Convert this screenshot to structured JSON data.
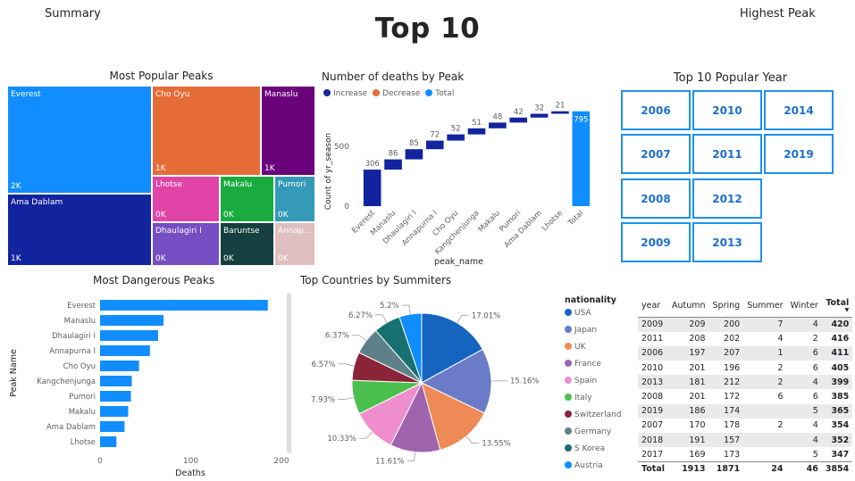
{
  "header": {
    "summary_label": "Summary",
    "title": "Top 10",
    "highest_peak_label": "Highest Peak"
  },
  "colors": {
    "accent": "#118DFF",
    "navy": "#12239E",
    "orange": "#E66C37",
    "purple": "#6B007B",
    "pink": "#E044A7",
    "green": "#1AAB40",
    "teal": "#3599B8",
    "plum": "#744EC2",
    "darkgreen": "#15403F",
    "rose": "#DFBFBF"
  },
  "treemap": {
    "title": "Most Popular Peaks",
    "cells": [
      {
        "label": "Everest",
        "value": "2K",
        "color": "#118DFF"
      },
      {
        "label": "Ama Dablam",
        "value": "1K",
        "color": "#12239E"
      },
      {
        "label": "Cho Oyu",
        "value": "1K",
        "color": "#E66C37"
      },
      {
        "label": "Manaslu",
        "value": "1K",
        "color": "#6B007B"
      },
      {
        "label": "Lhotse",
        "value": "0K",
        "color": "#E044A7"
      },
      {
        "label": "Makalu",
        "value": "0K",
        "color": "#1AAB40"
      },
      {
        "label": "Pumori",
        "value": "0K",
        "color": "#3599B8"
      },
      {
        "label": "Dhaulagiri I",
        "value": "0K",
        "color": "#744EC2"
      },
      {
        "label": "Baruntse",
        "value": "0K",
        "color": "#15403F"
      },
      {
        "label": "Annap...",
        "value": "0K",
        "color": "#DFBFBF"
      }
    ]
  },
  "waterfall": {
    "title": "Number of deaths by Peak",
    "legend": [
      "Increase",
      "Decrease",
      "Total"
    ],
    "legend_colors": [
      "#12239E",
      "#E66C37",
      "#118DFF"
    ],
    "ylabel": "Count of yr_season",
    "xlabel": "peak_name",
    "yticks": [
      "0",
      "500"
    ]
  },
  "year_slicer": {
    "title": "Top 10 Popular Year",
    "years": [
      "2006",
      "2010",
      "2014",
      "2007",
      "2011",
      "2019",
      "2008",
      "2012",
      "2009",
      "2013"
    ]
  },
  "bar": {
    "title": "Most Dangerous Peaks",
    "ylabel": "Peak Name",
    "xlabel": "Deaths",
    "xticks": [
      "0",
      "100",
      "200"
    ]
  },
  "pie": {
    "title": "Top Countries by Summiters",
    "legend_title": "nationality"
  },
  "matrix": {
    "columns": [
      "year",
      "Autumn",
      "Spring",
      "Summer",
      "Winter",
      "Total"
    ],
    "rows": [
      [
        "2009",
        "209",
        "200",
        "7",
        "4",
        "420"
      ],
      [
        "2011",
        "208",
        "202",
        "4",
        "2",
        "416"
      ],
      [
        "2006",
        "197",
        "207",
        "1",
        "6",
        "411"
      ],
      [
        "2010",
        "201",
        "196",
        "2",
        "6",
        "405"
      ],
      [
        "2013",
        "181",
        "212",
        "2",
        "4",
        "399"
      ],
      [
        "2008",
        "201",
        "172",
        "6",
        "6",
        "385"
      ],
      [
        "2019",
        "186",
        "174",
        "",
        "5",
        "365"
      ],
      [
        "2007",
        "170",
        "178",
        "2",
        "4",
        "354"
      ],
      [
        "2018",
        "191",
        "157",
        "",
        "4",
        "352"
      ],
      [
        "2017",
        "169",
        "173",
        "",
        "5",
        "347"
      ]
    ],
    "total": [
      "Total",
      "1913",
      "1871",
      "24",
      "46",
      "3854"
    ]
  },
  "chart_data": [
    {
      "type": "waterfall",
      "title": "Number of deaths by Peak",
      "xlabel": "peak_name",
      "ylabel": "Count of yr_season",
      "categories": [
        "Everest",
        "Manaslu",
        "Dhaulagiri I",
        "Annapurna I",
        "Cho Oyu",
        "Kangchenjunga",
        "Makalu",
        "Pumori",
        "Ama Dablam",
        "Lhotse",
        "Total"
      ],
      "values": [
        306,
        86,
        85,
        72,
        52,
        51,
        48,
        42,
        32,
        21,
        795
      ],
      "labels": [
        "306",
        "86",
        "85",
        "72",
        "52",
        "51",
        "48",
        "42",
        "32",
        "21",
        "795"
      ],
      "ylim": [
        0,
        800
      ]
    },
    {
      "type": "bar",
      "orientation": "horizontal",
      "title": "Most Dangerous Peaks",
      "xlabel": "Deaths",
      "ylabel": "Peak Name",
      "categories": [
        "Everest",
        "Manaslu",
        "Dhaulagiri I",
        "Annapurna I",
        "Cho Oyu",
        "Kangchenjunga",
        "Pumori",
        "Makalu",
        "Ama Dablam",
        "Lhotse"
      ],
      "values": [
        185,
        70,
        64,
        55,
        43,
        35,
        34,
        31,
        27,
        18
      ],
      "xlim": [
        0,
        200
      ]
    },
    {
      "type": "pie",
      "title": "Top Countries by Summiters",
      "categories": [
        "USA",
        "Japan",
        "UK",
        "France",
        "Spain",
        "Italy",
        "Switzerland",
        "Germany",
        "S Korea",
        "Austria"
      ],
      "values": [
        17.01,
        15.16,
        13.55,
        11.61,
        10.33,
        7.93,
        6.57,
        6.37,
        6.27,
        5.2
      ],
      "labels": [
        "17.01%",
        "15.16%",
        "13.55%",
        "11.61%",
        "10.33%",
        "7.93%",
        "6.57%",
        "6.37%",
        "6.27%",
        "5.2%"
      ],
      "colors": [
        "#1565C0",
        "#6B7BC8",
        "#EE8A55",
        "#A064AE",
        "#EE8ECD",
        "#4CC04E",
        "#8B2438",
        "#5E8088",
        "#177171",
        "#118DFF"
      ]
    }
  ]
}
